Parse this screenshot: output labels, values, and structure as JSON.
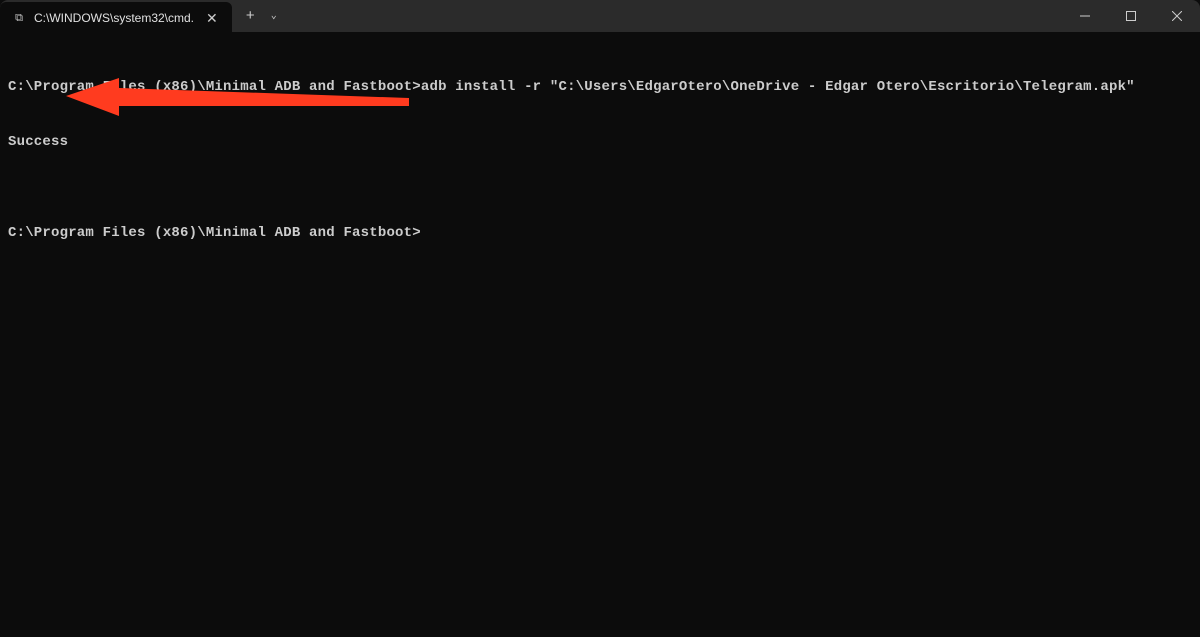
{
  "titlebar": {
    "tab": {
      "icon_glyph": "⧉",
      "title": "C:\\WINDOWS\\system32\\cmd.",
      "close_glyph": "✕"
    },
    "new_tab_glyph": "+",
    "dropdown_glyph": "⌄"
  },
  "window_controls": {
    "minimize_glyph": "—",
    "maximize_glyph": "▢",
    "close_glyph": "✕"
  },
  "terminal": {
    "line1": "C:\\Program Files (x86)\\Minimal ADB and Fastboot>adb install -r \"C:\\Users\\EdgarOtero\\OneDrive - Edgar Otero\\Escritorio\\Telegram.apk\"",
    "line2": "Success",
    "line3": "",
    "line4": "C:\\Program Files (x86)\\Minimal ADB and Fastboot>"
  },
  "annotation": {
    "color": "#ff3b1f"
  }
}
